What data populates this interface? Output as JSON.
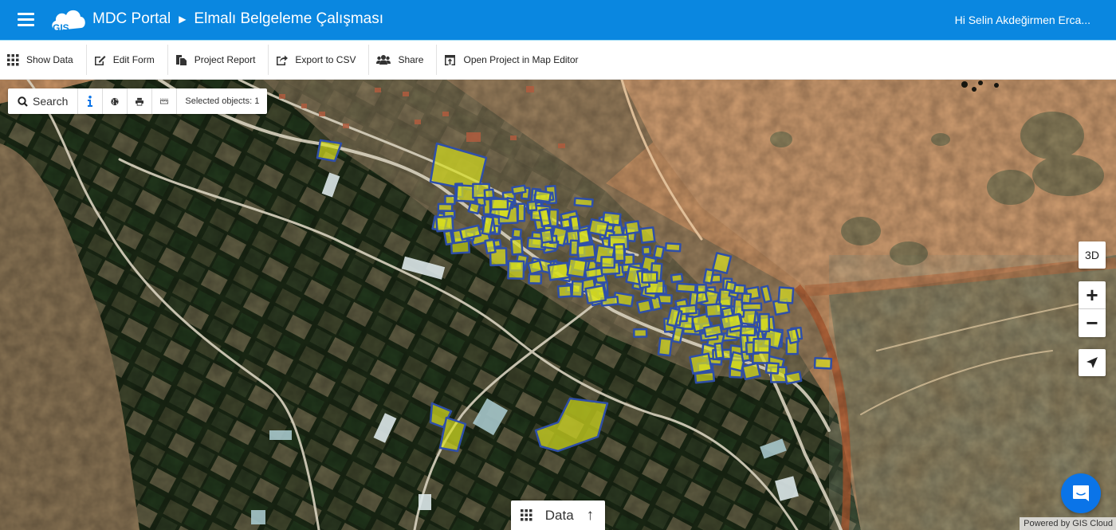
{
  "header": {
    "app_name": "MDC Portal",
    "breadcrumb_separator": "▶",
    "project_title": "Elmalı Belgeleme Çalışması",
    "logo_text": "GIS",
    "user_greeting": "Hi Selin Akdeğirmen Erca..."
  },
  "toolbar": {
    "items": [
      {
        "label": "Show Data",
        "icon": "grid-icon"
      },
      {
        "label": "Edit Form",
        "icon": "edit-icon"
      },
      {
        "label": "Project Report",
        "icon": "copy-icon"
      },
      {
        "label": "Export to CSV",
        "icon": "export-icon"
      },
      {
        "label": "Share",
        "icon": "users-icon"
      },
      {
        "label": "Open Project in Map Editor",
        "icon": "open-editor-icon"
      }
    ]
  },
  "map_toolbar": {
    "search_label": "Search",
    "selected_objects_label": "Selected objects: 1",
    "info_color": "#0a74e8"
  },
  "map_controls": {
    "btn_3d": "3D",
    "zoom_in": "+",
    "zoom_out": "−"
  },
  "data_panel": {
    "label": "Data",
    "arrow": "↑"
  },
  "attribution": "Powered by GIS Cloud",
  "colors": {
    "brand": "#0a87e0",
    "parcel_fill": "#d9e021",
    "parcel_stroke": "#2f4fa8",
    "chat": "#0a74e8"
  }
}
